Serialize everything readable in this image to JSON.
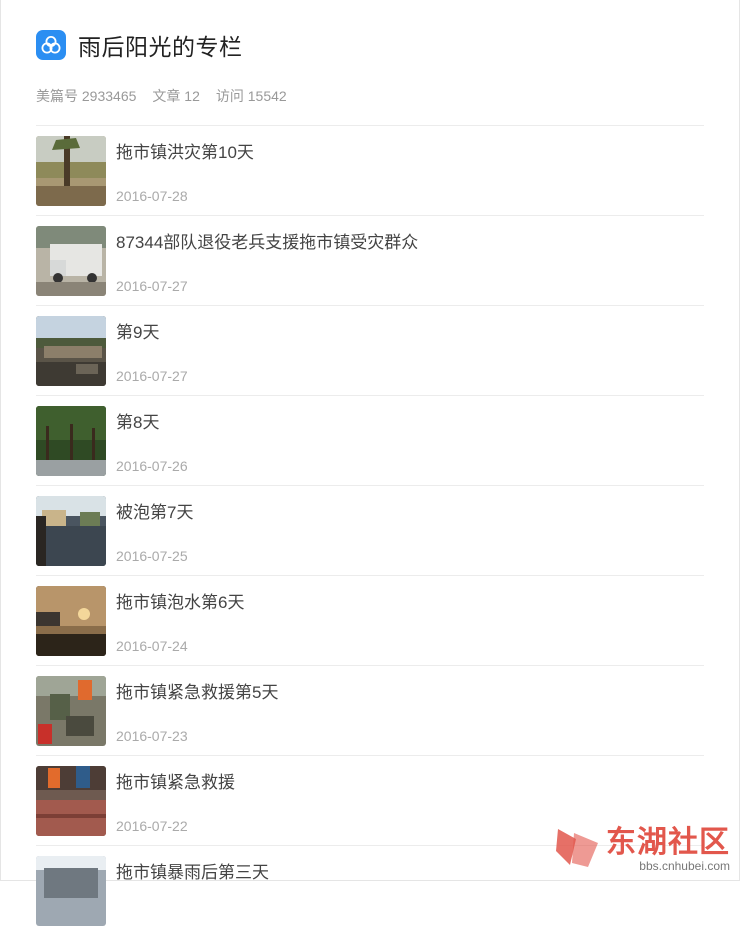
{
  "header": {
    "title": "雨后阳光的专栏"
  },
  "stats": {
    "meipian_id": "美篇号 2933465",
    "articles": "文章 12",
    "visits": "访问 15542"
  },
  "articles": [
    {
      "title": "拖市镇洪灾第10天",
      "date": "2016-07-28"
    },
    {
      "title": "87344部队退役老兵支援拖市镇受灾群众",
      "date": "2016-07-27"
    },
    {
      "title": "第9天",
      "date": "2016-07-27"
    },
    {
      "title": "第8天",
      "date": "2016-07-26"
    },
    {
      "title": "被泡第7天",
      "date": "2016-07-25"
    },
    {
      "title": "拖市镇泡水第6天",
      "date": "2016-07-24"
    },
    {
      "title": "拖市镇紧急救援第5天",
      "date": "2016-07-23"
    },
    {
      "title": "拖市镇紧急救援",
      "date": "2016-07-22"
    },
    {
      "title": "拖市镇暴雨后第三天",
      "date": ""
    }
  ],
  "watermark": {
    "name": "东湖社区",
    "url": "bbs.cnhubei.com"
  },
  "colors": {
    "accent": "#2b8ef2",
    "watermark": "#e2574c"
  }
}
